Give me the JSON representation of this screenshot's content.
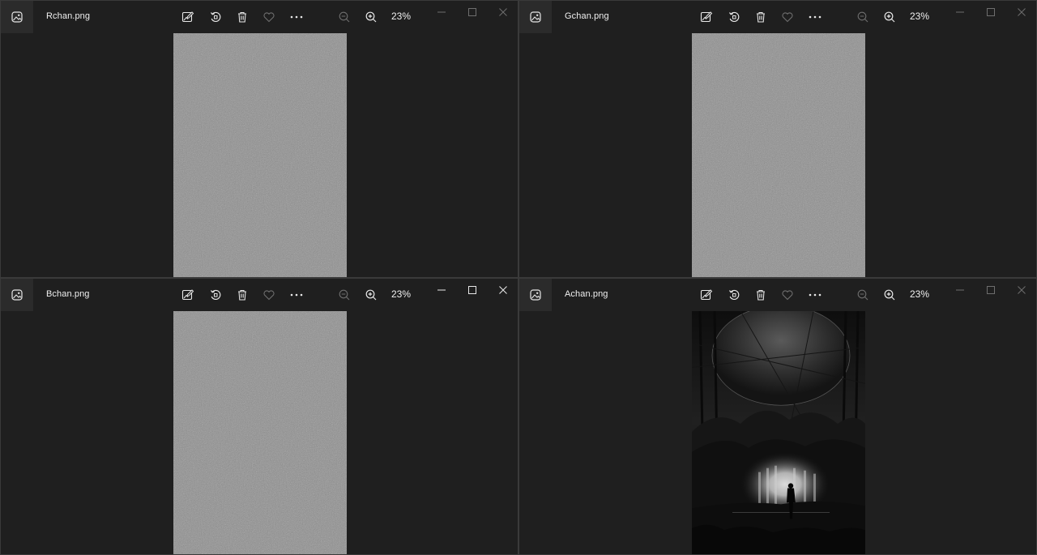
{
  "windows": [
    {
      "filename": "Rchan.png",
      "zoom": "23%",
      "content": "noise"
    },
    {
      "filename": "Gchan.png",
      "zoom": "23%",
      "content": "noise"
    },
    {
      "filename": "Bchan.png",
      "zoom": "23%",
      "content": "noise"
    },
    {
      "filename": "Achan.png",
      "zoom": "23%",
      "content": "artwork"
    }
  ],
  "icons": {
    "app": "photos-app-icon",
    "edit": "edit-image-icon",
    "rotate": "rotate-icon",
    "delete": "trash-icon",
    "favorite": "heart-icon",
    "more": "more-options-icon",
    "zoom_out": "zoom-out-icon",
    "zoom_in": "zoom-in-icon",
    "minimize": "minimize-icon",
    "maximize": "maximize-icon",
    "close": "close-icon"
  },
  "colors": {
    "window_bg": "#1f1f1f",
    "titlebar_icon_bg": "#2b2b2b",
    "text": "#f0f0f0",
    "icon": "#e8e8e8",
    "icon_dim": "#6e6e6e",
    "noise_gray": "#8a8a8a"
  }
}
